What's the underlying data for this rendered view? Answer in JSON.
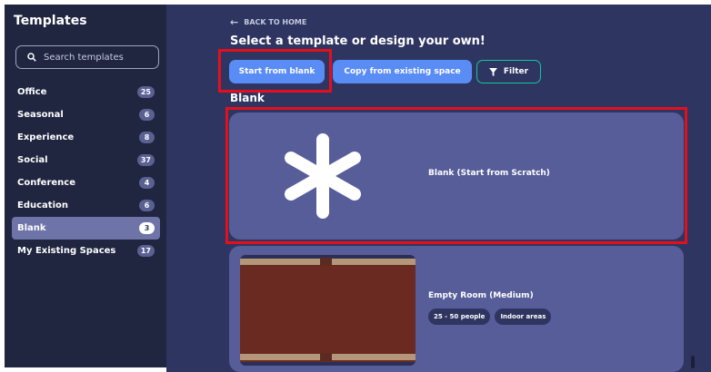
{
  "sidebar": {
    "title": "Templates",
    "search_placeholder": "Search templates",
    "items": [
      {
        "label": "Office",
        "count": "25"
      },
      {
        "label": "Seasonal",
        "count": "6"
      },
      {
        "label": "Experience",
        "count": "8"
      },
      {
        "label": "Social",
        "count": "37"
      },
      {
        "label": "Conference",
        "count": "4"
      },
      {
        "label": "Education",
        "count": "6"
      },
      {
        "label": "Blank",
        "count": "3"
      },
      {
        "label": "My Existing Spaces",
        "count": "17"
      }
    ]
  },
  "main": {
    "back_label": "BACK TO HOME",
    "heading": "Select a template or design your own!",
    "buttons": {
      "start_blank": "Start from blank",
      "copy_existing": "Copy from existing space",
      "filter": "Filter"
    },
    "section_title": "Blank",
    "cards": [
      {
        "title": "Blank (Start from Scratch)"
      },
      {
        "title": "Empty Room (Medium)",
        "tags": [
          "25 - 50 people",
          "Indoor areas"
        ]
      }
    ]
  },
  "colors": {
    "sidebar_bg": "#202540",
    "main_bg": "#2f3561",
    "card_bg": "#565d99",
    "accent_blue": "#5a8cf6",
    "accent_teal": "#13c79e",
    "highlight_red": "#e3101c"
  },
  "icons": [
    "search-icon",
    "back-arrow-icon",
    "filter-icon",
    "asterisk-icon"
  ]
}
